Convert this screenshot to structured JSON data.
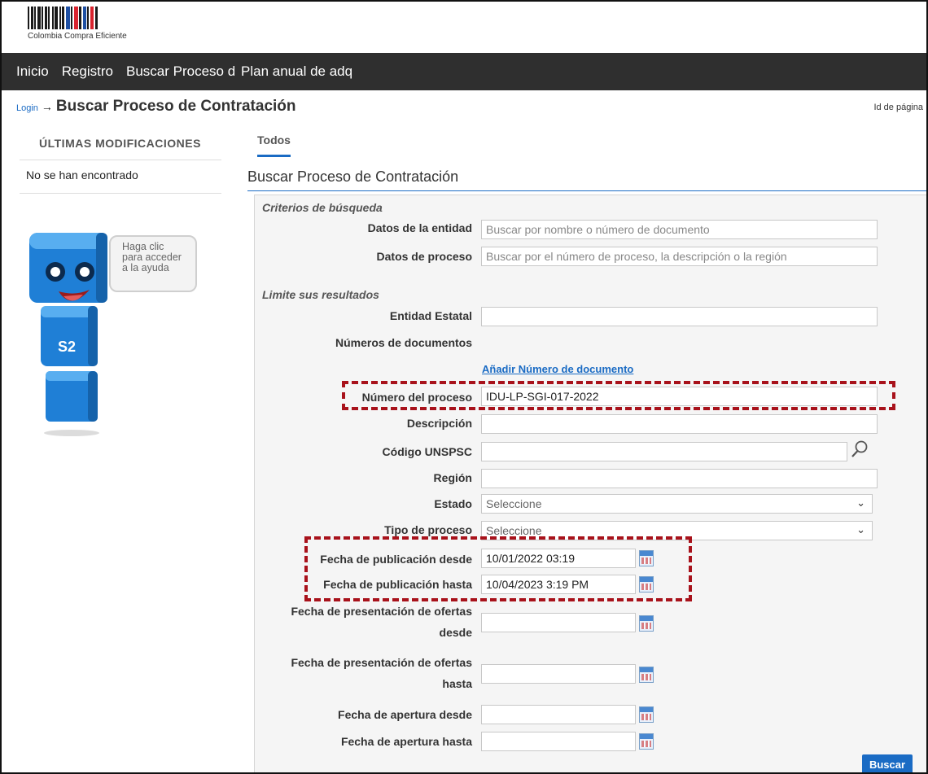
{
  "brand": {
    "name": "Colombia Compra Eficiente"
  },
  "nav": {
    "items": [
      "Inicio",
      "Registro",
      "Buscar Proceso de",
      "Plan anual de adq"
    ]
  },
  "breadcrumb": {
    "login": "Login",
    "arrow": "→",
    "title": "Buscar Proceso de Contratación"
  },
  "page_id": "Id de página",
  "sidebar": {
    "title": "ÚLTIMAS MODIFICACIONES",
    "empty": "No se han encontrado",
    "help": [
      "Haga clic",
      "para acceder",
      "a la ayuda"
    ],
    "mascot_label": "S2"
  },
  "tabs": [
    "Todos"
  ],
  "section_title": "Buscar Proceso de Contratación",
  "criteria": {
    "heading": "Criterios de búsqueda",
    "entity_label": "Datos de la entidad",
    "entity_placeholder": "Buscar por nombre o número de documento",
    "process_label": "Datos de proceso",
    "process_placeholder": "Buscar por el número de proceso, la descripción o la región"
  },
  "limits": {
    "heading": "Limite sus resultados",
    "entidad_estatal": "Entidad Estatal",
    "numeros_documentos": "Números de documentos",
    "add_doc_link": "Añadir Número de documento",
    "numero_proceso": "Número del proceso",
    "numero_proceso_value": "IDU-LP-SGI-017-2022",
    "descripcion": "Descripción",
    "codigo_unspsc": "Código UNSPSC",
    "region": "Región",
    "estado": "Estado",
    "estado_value": "Seleccione",
    "tipo_proceso": "Tipo de proceso",
    "tipo_proceso_value": "Seleccione",
    "pub_desde": "Fecha de publicación desde",
    "pub_desde_value": "10/01/2022 03:19",
    "pub_hasta": "Fecha de publicación hasta",
    "pub_hasta_value": "10/04/2023 3:19 PM",
    "ofertas_desde_1": "Fecha de presentación de ofertas",
    "ofertas_desde_2": "desde",
    "ofertas_hasta_1": "Fecha de presentación de ofertas",
    "ofertas_hasta_2": "hasta",
    "apertura_desde": "Fecha de apertura desde",
    "apertura_hasta": "Fecha de apertura hasta"
  },
  "actions": {
    "search": "Buscar"
  },
  "colors": {
    "accent": "#1a6bc4",
    "highlight": "#a8121b",
    "nav_bg": "#2f2f2f"
  }
}
